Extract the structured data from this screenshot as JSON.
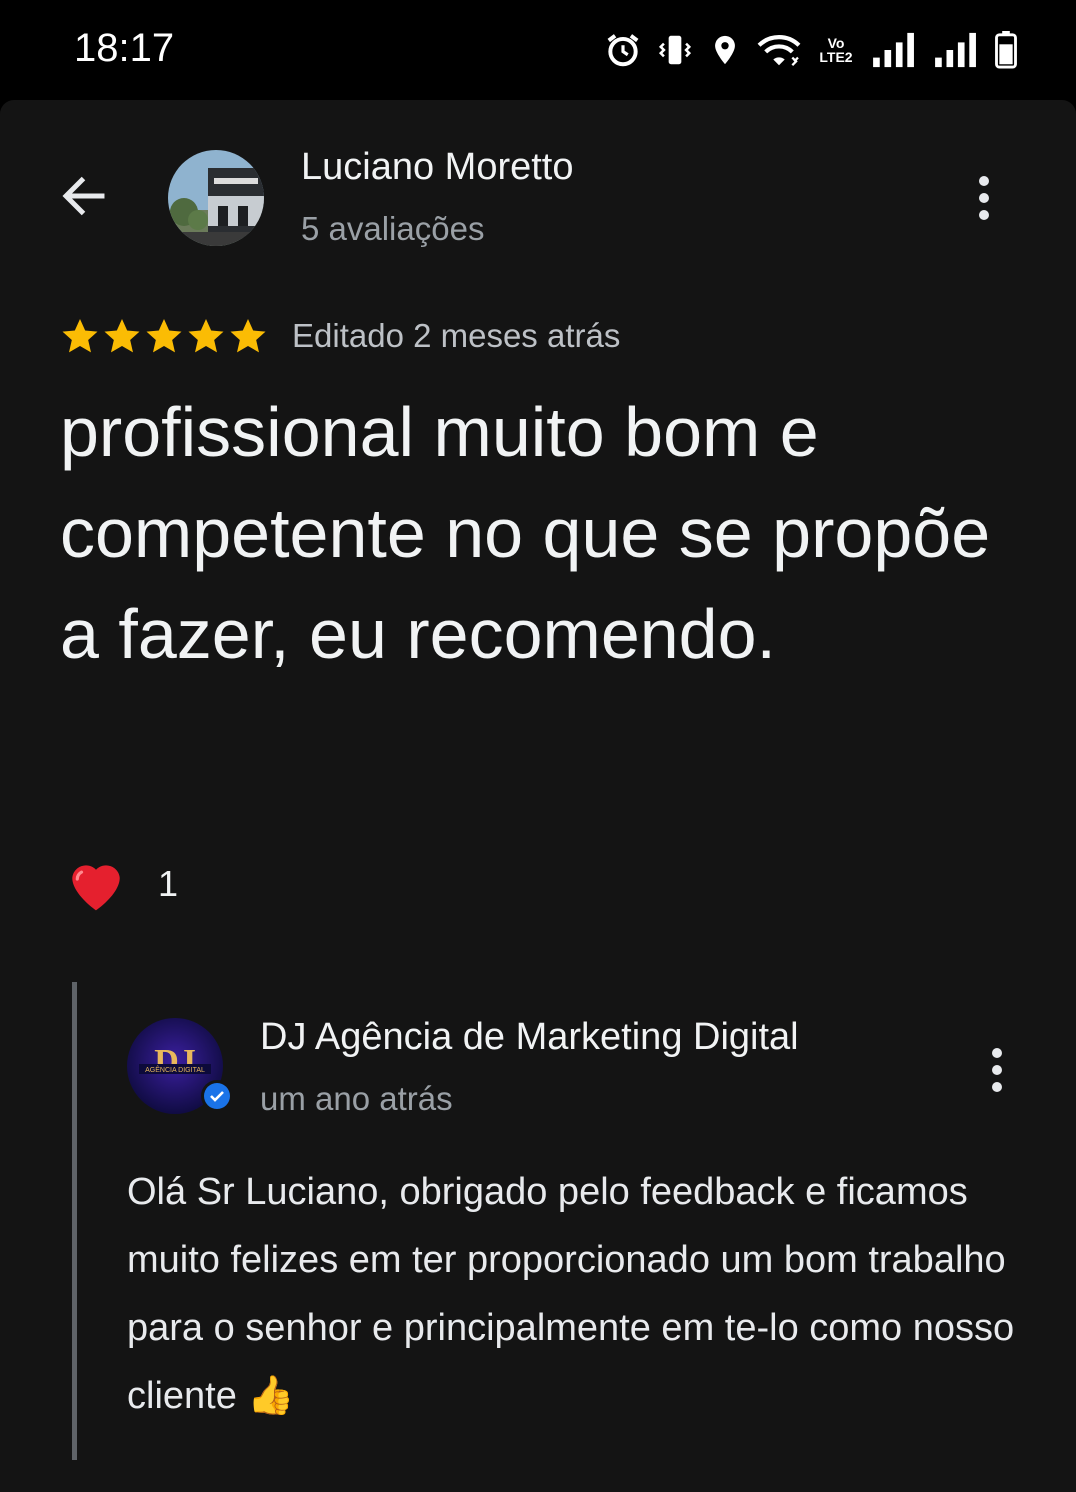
{
  "status_bar": {
    "time": "18:17",
    "volte": "Vo LTE2",
    "icons": [
      "alarm-icon",
      "vibrate-icon",
      "location-icon",
      "wifi-icon",
      "volte-icon",
      "signal-icon",
      "signal-icon",
      "battery-icon"
    ]
  },
  "header": {
    "reviewer_name": "Luciano Moretto",
    "review_count": "5 avaliações"
  },
  "review": {
    "rating": 5,
    "max_rating": 5,
    "star_color": "#fbbc04",
    "edited": "Editado 2 meses atrás",
    "text": "profissional muito bom e competente no que se propõe a fazer, eu recomendo.",
    "reaction_emoji": "❤️",
    "reaction_count": "1"
  },
  "reply": {
    "owner_name": "DJ Agência de Marketing Digital",
    "avatar_initials": "DJ",
    "avatar_caption": "AGÊNCIA DIGITAL",
    "time": "um ano atrás",
    "text": "Olá Sr Luciano, obrigado pelo feedback e ficamos muito felizes em ter proporcionado um bom trabalho para o senhor e principalmente em te-lo como nosso cliente 👍",
    "verified_color": "#1a73e8"
  }
}
